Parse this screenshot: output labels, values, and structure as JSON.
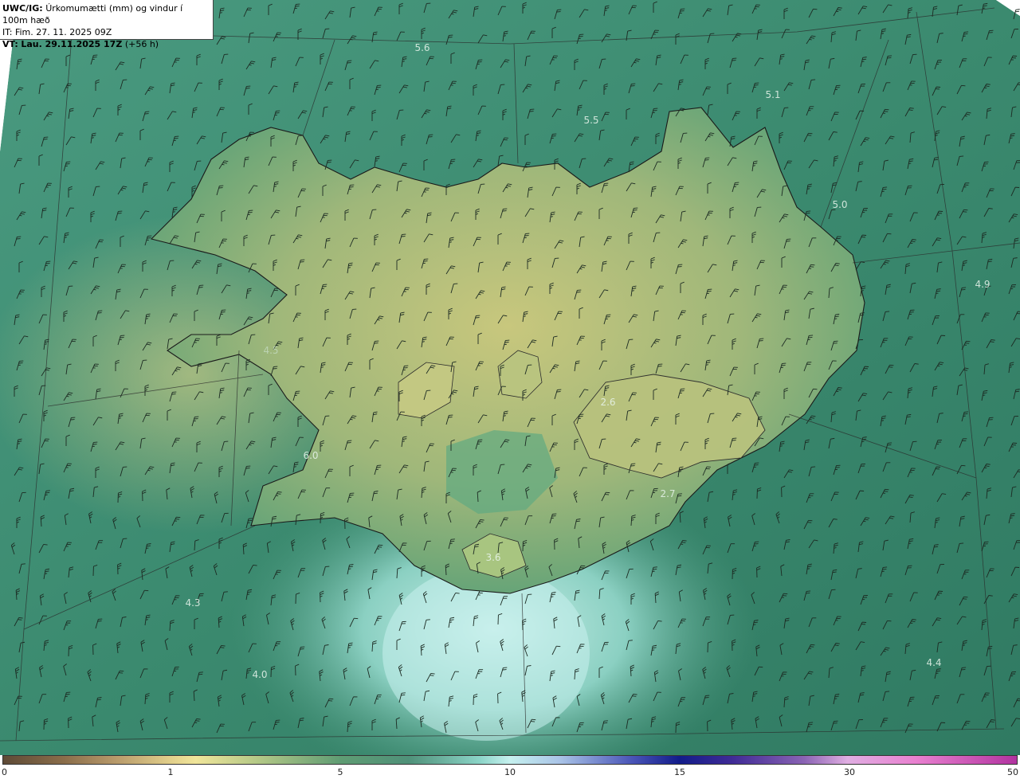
{
  "header": {
    "model": "UWC/IG:",
    "title": "Úrkomumætti (mm) og vindur í 100m hæð",
    "init_time": "IT: Fim. 27. 11. 2025 09Z",
    "valid_label": "VT:",
    "valid_time": "Lau. 29.11.2025 17Z",
    "lead_time": "(+56 h)"
  },
  "value_labels": [
    "5.6",
    "5.5",
    "5.1",
    "5.0",
    "4.9",
    "6.0",
    "2.6",
    "2.7",
    "3.6",
    "4.3",
    "4.0",
    "4.4",
    "4.5"
  ],
  "colorbar": {
    "ticks": [
      "0",
      "1",
      "5",
      "10",
      "15",
      "30",
      "50"
    ],
    "colors": [
      "#5e4a36",
      "#e3d18c",
      "#5f9c73",
      "#c6f1ef",
      "#121c8a",
      "#e0aee2",
      "#b233a0"
    ]
  },
  "colors": {
    "sea": "#3f8a70",
    "land_low": "#c8c77d",
    "land_high": "#5aa077",
    "south_sea": "#9ed8cc",
    "coastline": "#1a1a1a"
  }
}
